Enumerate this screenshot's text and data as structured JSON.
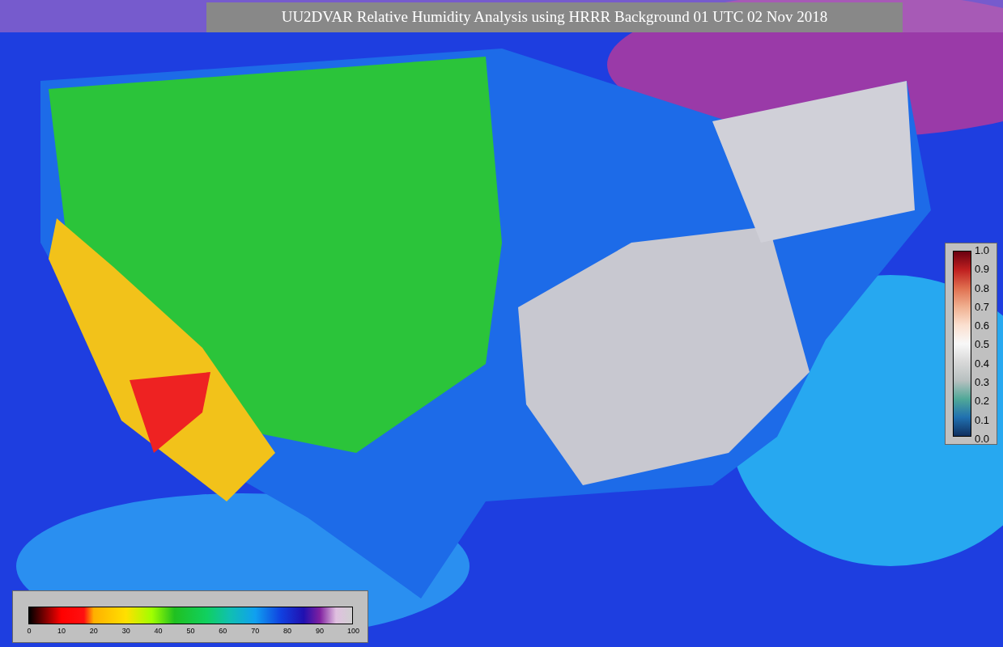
{
  "title": "UU2DVAR Relative Humidity Analysis using HRRR Background 01 UTC 02 Nov 2018",
  "observation_colorbar": {
    "ticks": [
      "1.0",
      "0.9",
      "0.8",
      "0.7",
      "0.6",
      "0.5",
      "0.4",
      "0.3",
      "0.2",
      "0.1",
      "0.0"
    ]
  },
  "humidity_colorbar": {
    "ticks": [
      "0",
      "10",
      "20",
      "30",
      "40",
      "50",
      "60",
      "70",
      "80",
      "90",
      "100"
    ]
  }
}
